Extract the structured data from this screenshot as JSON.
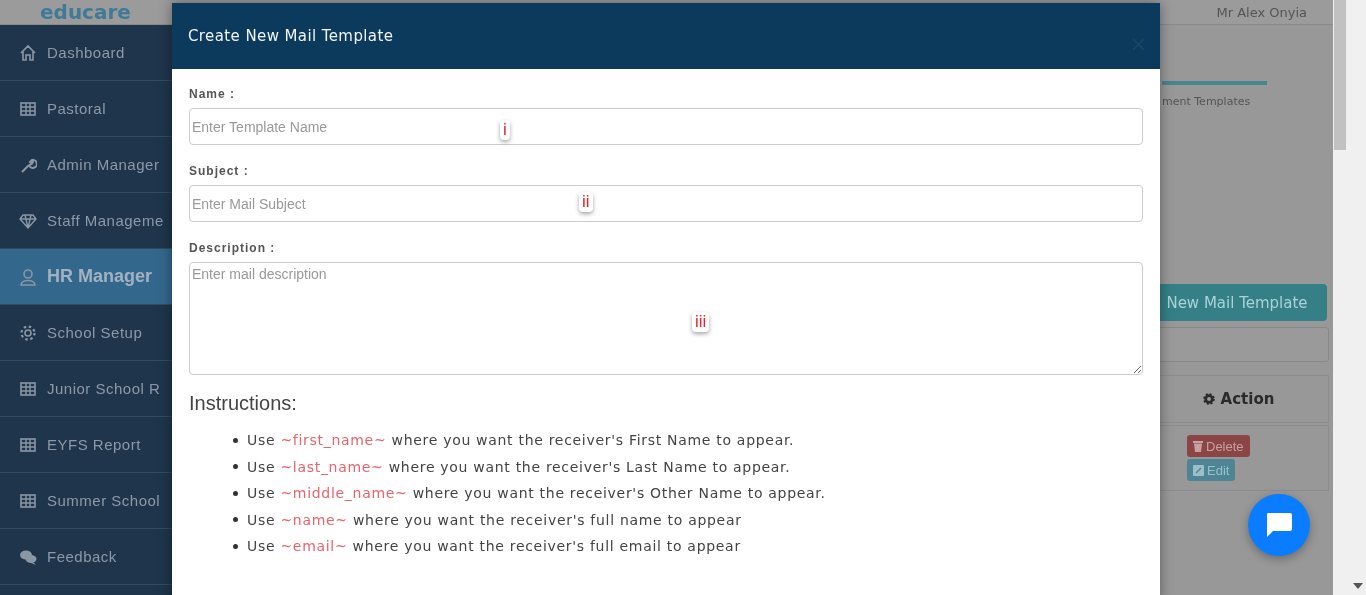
{
  "header": {
    "logo": "educare",
    "user": "Mr Alex Onyia"
  },
  "sidebar": {
    "items": [
      {
        "label": "Dashboard",
        "kind": "home",
        "selected": false
      },
      {
        "label": "Pastoral",
        "kind": "table",
        "selected": false
      },
      {
        "label": "Admin Manager",
        "kind": "tool",
        "selected": false
      },
      {
        "label": "Staff Manageme",
        "kind": "staff",
        "selected": false
      },
      {
        "label": "HR Manager",
        "kind": "people",
        "selected": true
      },
      {
        "label": "School Setup",
        "kind": "settings",
        "selected": false
      },
      {
        "label": "Junior School R",
        "kind": "table",
        "selected": false
      },
      {
        "label": "EYFS Report",
        "kind": "table",
        "selected": false
      },
      {
        "label": "Summer School",
        "kind": "table",
        "selected": false
      },
      {
        "label": "Feedback",
        "kind": "feedback",
        "selected": false
      }
    ]
  },
  "background": {
    "tab": "ment Templates",
    "new_button": "New Mail Template",
    "table": {
      "columns": [
        "Action"
      ],
      "rows": [
        {
          "actions": [
            {
              "label": "Delete",
              "kind": "delete"
            },
            {
              "label": "Edit",
              "kind": "edit"
            }
          ]
        }
      ]
    }
  },
  "modal": {
    "title": "Create New Mail Template",
    "fields": [
      {
        "label": "Name :",
        "placeholder": "Enter Template Name",
        "kind": "input",
        "marker": "i"
      },
      {
        "label": "Subject :",
        "placeholder": "Enter Mail Subject",
        "kind": "input",
        "marker": "ii"
      },
      {
        "label": "Description :",
        "placeholder": "Enter mail description",
        "kind": "textarea",
        "marker": "iii"
      }
    ],
    "instructions_title": "Instructions:",
    "instructions": [
      {
        "before": "Use",
        "token": "~first_name~",
        "after": "where you want the receiver's First Name to appear."
      },
      {
        "before": "Use",
        "token": "~last_name~",
        "after": "where you want the receiver's Last Name to appear."
      },
      {
        "before": "Use",
        "token": "~middle_name~",
        "after": "where you want the receiver's Other Name to appear."
      },
      {
        "before": "Use",
        "token": "~name~",
        "after": "where you want the receiver's full name to appear"
      },
      {
        "before": "Use",
        "token": "~email~",
        "after": "where you want the receiver's full email to appear"
      }
    ]
  }
}
